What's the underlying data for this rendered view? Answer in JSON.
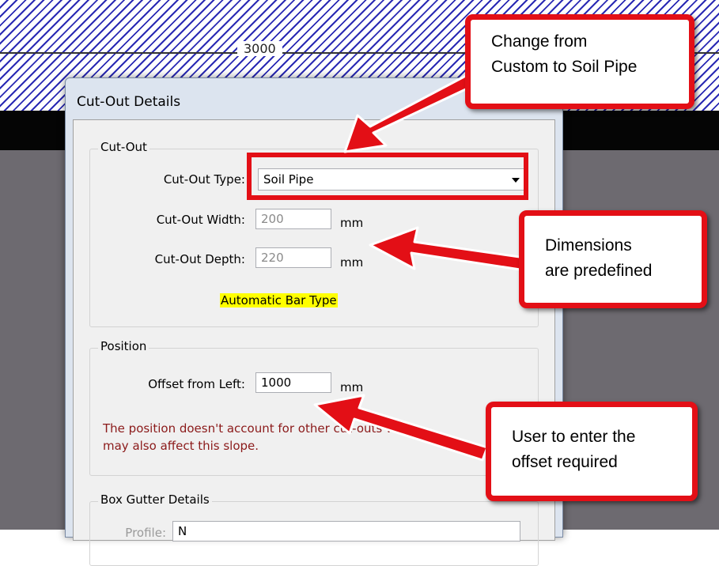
{
  "drawing": {
    "dimension_label": "3000"
  },
  "dialog": {
    "title": "Cut-Out Details",
    "cutout_group": {
      "legend": "Cut-Out",
      "type_label": "Cut-Out Type:",
      "type_value": "Soil Pipe",
      "width_label": "Cut-Out Width:",
      "width_value": "200",
      "width_unit": "mm",
      "depth_label": "Cut-Out Depth:",
      "depth_value": "220",
      "depth_unit": "mm",
      "bar_type_note": "Automatic Bar Type"
    },
    "position_group": {
      "legend": "Position",
      "offset_label": "Offset from Left:",
      "offset_value": "1000",
      "offset_unit": "mm",
      "warning_line1": "The position doesn't account for other cut-outs wh",
      "warning_line2": "may also affect this slope."
    },
    "box_gutter_group": {
      "legend": "Box Gutter Details",
      "profile_label": "Profile:",
      "profile_value": "N"
    }
  },
  "callouts": {
    "type_change": {
      "line1": "Change from",
      "line2": "Custom to Soil Pipe"
    },
    "dimensions": {
      "line1": "Dimensions",
      "line2": "are predefined"
    },
    "offset": {
      "line1": "User to enter the",
      "line2": "offset required"
    }
  },
  "colors": {
    "annotation_red": "#e30f16",
    "hatch_blue": "#2a2ab4",
    "warning_text": "#8b1a1a",
    "highlight_yellow": "#ffff00"
  }
}
